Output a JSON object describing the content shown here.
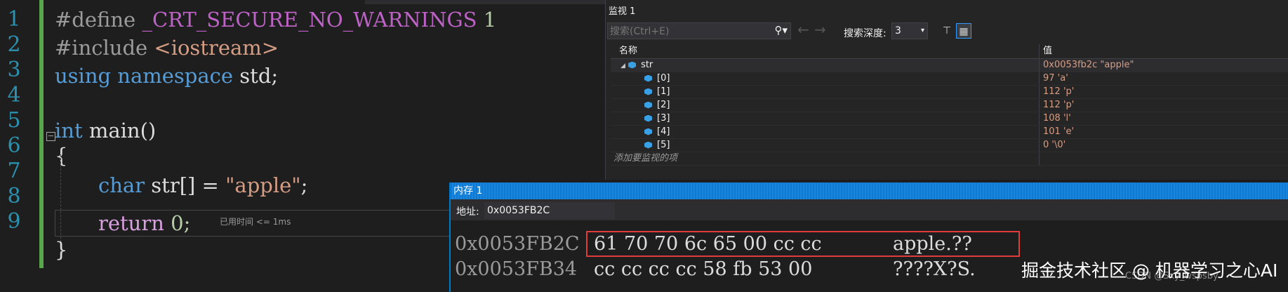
{
  "editor": {
    "line_numbers": [
      "1",
      "2",
      "3",
      "4",
      "5",
      "6",
      "7",
      "8",
      "9"
    ],
    "lines": {
      "l1_directive": "#define",
      "l1_macro": "_CRT_SECURE_NO_WARNINGS",
      "l1_value": "1",
      "l2_directive": "#include",
      "l2_header": "<iostream>",
      "l3_using": "using",
      "l3_namespace": "namespace",
      "l3_std": "std;",
      "l5_int": "int",
      "l5_main": "main()",
      "l6_brace": "{",
      "l7_char": "char",
      "l7_rest": "str[] =",
      "l7_string": "\"apple\"",
      "l7_semicolon": ";",
      "l8_return": "return",
      "l8_zero": "0;",
      "l9_brace": "}"
    },
    "perf_tip": "已用时间 <= 1ms"
  },
  "watch": {
    "title": "监视 1",
    "search_placeholder": "搜索(Ctrl+E)",
    "depth_label": "搜索深度:",
    "depth_value": "3",
    "columns": {
      "name": "名称",
      "value": "值"
    },
    "root": {
      "name": "str",
      "value": "0x0053fb2c \"apple\""
    },
    "items": [
      {
        "name": "[0]",
        "value": "97 'a'"
      },
      {
        "name": "[1]",
        "value": "112 'p'"
      },
      {
        "name": "[2]",
        "value": "112 'p'"
      },
      {
        "name": "[3]",
        "value": "108 'l'"
      },
      {
        "name": "[4]",
        "value": "101 'e'"
      },
      {
        "name": "[5]",
        "value": "0 '\\0'"
      }
    ],
    "add_watch": "添加要监视的项"
  },
  "memory": {
    "title": "内存 1",
    "address_label": "地址:",
    "address_value": "0x0053FB2C",
    "rows": [
      {
        "address": "0x0053FB2C",
        "bytes": "61 70 70 6c 65 00 cc cc",
        "chars": "apple.??"
      },
      {
        "address": "0x0053FB34",
        "bytes": "cc cc cc cc 58 fb 53 00",
        "chars": "????X?S."
      }
    ]
  },
  "watermark": {
    "main": "掘金技术社区 @ 机器学习之心AI",
    "small": "CSDN @Sxy_wspsby"
  },
  "colors": {
    "accent": "#007acc",
    "highlight": "#e03c3c",
    "gutter_change": "#57a64a"
  }
}
